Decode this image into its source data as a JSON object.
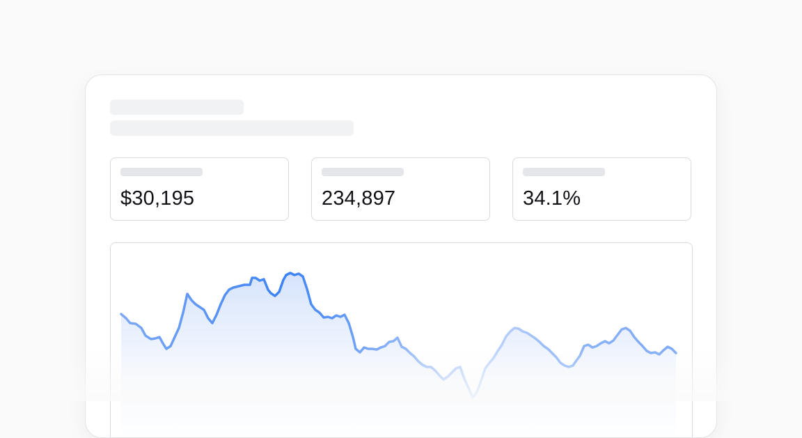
{
  "stats": [
    {
      "value": "$30,195"
    },
    {
      "value": "234,897"
    },
    {
      "value": "34.1%"
    }
  ],
  "colors": {
    "accent": "#3b82f6",
    "line_fade": "#c6dbfb",
    "area_top": "#d6e4fb"
  }
}
